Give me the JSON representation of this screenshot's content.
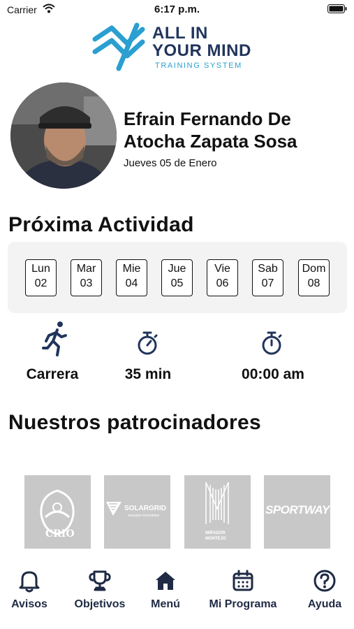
{
  "status_bar": {
    "carrier": "Carrier",
    "time": "6:17 p.m."
  },
  "logo": {
    "line1": "ALL IN",
    "line2": "YOUR MIND",
    "subtitle": "TRAINING SYSTEM",
    "colors": {
      "dark": "#21355c",
      "accent": "#2a9fd0"
    }
  },
  "profile": {
    "name_line1": "Efrain Fernando De",
    "name_line2": "Atocha Zapata Sosa",
    "date": "Jueves 05 de Enero"
  },
  "next_activity": {
    "title": "Próxima Actividad",
    "days": [
      {
        "name": "Lun",
        "num": "02"
      },
      {
        "name": "Mar",
        "num": "03"
      },
      {
        "name": "Mie",
        "num": "04"
      },
      {
        "name": "Jue",
        "num": "05"
      },
      {
        "name": "Vie",
        "num": "06"
      },
      {
        "name": "Sab",
        "num": "07"
      },
      {
        "name": "Dom",
        "num": "08"
      }
    ],
    "details": {
      "type": "Carrera",
      "duration": "35 min",
      "time": "00:00 am"
    }
  },
  "sponsors": {
    "title": "Nuestros patrocinadores",
    "items": [
      {
        "name": "CRIO"
      },
      {
        "name": "SOLARGRID",
        "tagline": "energías renovables"
      },
      {
        "name": "MIRADOR",
        "name2": "MONTEJO"
      },
      {
        "name": "SPORTWAY"
      }
    ]
  },
  "tab_bar": {
    "accent": "#1f2a44",
    "tabs": [
      {
        "label": "Avisos",
        "icon": "bell-icon"
      },
      {
        "label": "Objetivos",
        "icon": "trophy-icon"
      },
      {
        "label": "Menú",
        "icon": "home-icon"
      },
      {
        "label": "Mi Programa",
        "icon": "calendar-icon"
      },
      {
        "label": "Ayuda",
        "icon": "help-icon"
      }
    ]
  }
}
